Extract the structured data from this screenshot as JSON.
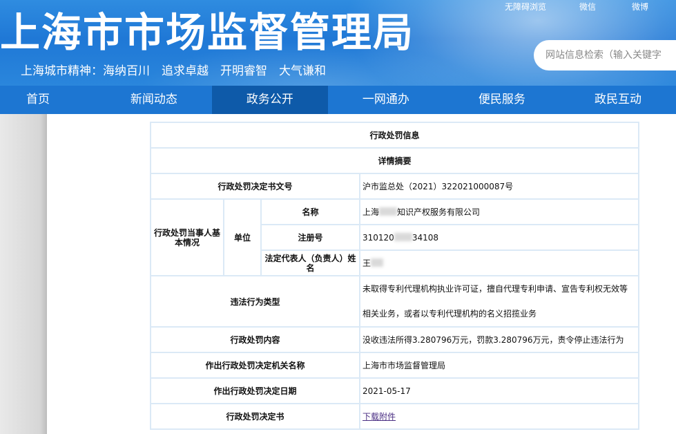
{
  "header": {
    "title": "上海市市场监督管理局",
    "slogan": "上海城市精神：海纳百川　追求卓越　开明睿智　大气谦和",
    "top_links": [
      "无障碍浏览",
      "微信",
      "微博"
    ],
    "search_placeholder": "网站信息检索（输入关键字"
  },
  "nav": {
    "items": [
      "首页",
      "新闻动态",
      "政务公开",
      "一网通办",
      "便民服务",
      "政民互动"
    ],
    "active": "政务公开"
  },
  "table": {
    "title": "行政处罚信息",
    "subtitle": "详情摘要",
    "rows": {
      "doc_no": {
        "label": "行政处罚决定书文号",
        "value": "沪市监总处（2021）322021000087号"
      },
      "party_label": "行政处罚当事人基本情况",
      "unit_label": "单位",
      "name": {
        "label": "名称",
        "value_prefix": "上海",
        "value_suffix": "知识产权服务有限公司"
      },
      "reg_no": {
        "label": "注册号",
        "value_prefix": "310120",
        "value_suffix": "34108"
      },
      "legal_rep": {
        "label": "法定代表人（负责人）姓名",
        "value_prefix": "王"
      },
      "violation": {
        "label": "违法行为类型",
        "value": "未取得专利代理机构执业许可证，擅自代理专利申请、宣告专利权无效等相关业务，或者以专利代理机构的名义招揽业务"
      },
      "content": {
        "label": "行政处罚内容",
        "value": "没收违法所得3.280796万元，罚款3.280796万元，责令停止违法行为"
      },
      "org": {
        "label": "作出行政处罚决定机关名称",
        "value": "上海市市场监督管理局"
      },
      "date": {
        "label": "作出行政处罚决定日期",
        "value": "2021-05-17"
      },
      "file": {
        "label": "行政处罚决定书",
        "link": "下载附件"
      }
    }
  }
}
